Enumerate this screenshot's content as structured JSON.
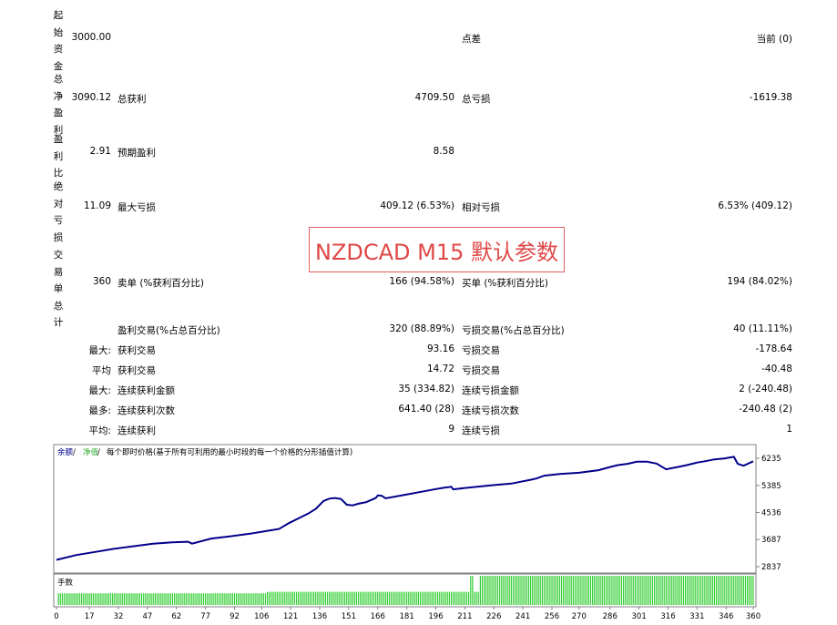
{
  "report": {
    "initial_deposit": {
      "label_chars": [
        "起",
        "始",
        "资",
        "金"
      ],
      "value": "3000.00",
      "spread_label": "点差",
      "spread_value": "当前 (0)"
    },
    "net_profit": {
      "label_chars": [
        "总",
        "净",
        "盈",
        "利"
      ],
      "value": "3090.12",
      "gross_profit_label": "总获利",
      "gross_profit_value": "4709.50",
      "gross_loss_label": "总亏损",
      "gross_loss_value": "-1619.38"
    },
    "profit_factor": {
      "label_chars": [
        "盈",
        "利",
        "比"
      ],
      "value": "2.91",
      "expected_payoff_label": "预期盈利",
      "expected_payoff_value": "8.58"
    },
    "absolute_drawdown": {
      "label_chars": [
        "绝",
        "对",
        "亏",
        "损"
      ],
      "value": "11.09",
      "max_dd_label": "最大亏损",
      "max_dd_value": "409.12 (6.53%)",
      "rel_dd_label": "相对亏损",
      "rel_dd_value": "6.53% (409.12)"
    },
    "total_trades": {
      "label_chars": [
        "交",
        "易",
        "单",
        "总",
        "计"
      ],
      "value": "360",
      "short_label": "卖单 (%获利百分比)",
      "short_value": "166 (94.58%)",
      "long_label": "买单 (%获利百分比)",
      "long_value": "194 (84.02%)"
    },
    "rows": [
      {
        "prefix": "",
        "l_label": "盈利交易(%占总百分比)",
        "l_value": "320 (88.89%)",
        "r_label": "亏损交易(%占总百分比)",
        "r_value": "40 (11.11%)"
      },
      {
        "prefix": "最大:",
        "l_label": "获利交易",
        "l_value": "93.16",
        "r_label": "亏损交易",
        "r_value": "-178.64"
      },
      {
        "prefix": "平均",
        "l_label": "获利交易",
        "l_value": "14.72",
        "r_label": "亏损交易",
        "r_value": "-40.48"
      },
      {
        "prefix": "最大:",
        "l_label": "连续获利金额",
        "l_value": "35 (334.82)",
        "r_label": "连续亏损金额",
        "r_value": "2 (-240.48)"
      },
      {
        "prefix": "最多:",
        "l_label": "连续获利次数",
        "l_value": "641.40 (28)",
        "r_label": "连续亏损次数",
        "r_value": "-240.48 (2)"
      },
      {
        "prefix": "平均:",
        "l_label": "连续获利",
        "l_value": "9",
        "r_label": "连续亏损",
        "r_value": "1"
      }
    ]
  },
  "stamp": "NZDCAD M15 默认参数",
  "chart": {
    "legend_balance": "余额",
    "legend_sep1": " / ",
    "legend_equity": "净值",
    "legend_sep2": " / ",
    "legend_text": "每个即时价格(基于所有可利用的最小时段的每一个价格的分形插值计算)",
    "lots_label": "手数",
    "colors": {
      "balance": "#00008b",
      "equity_legend": "#2fa82f",
      "lots": "#32cd32"
    }
  },
  "chart_data": {
    "type": "line",
    "y_ticks": [
      6235,
      5385,
      4536,
      3687,
      2837
    ],
    "x_ticks": [
      0,
      17,
      32,
      47,
      62,
      77,
      92,
      106,
      121,
      136,
      151,
      166,
      181,
      196,
      211,
      226,
      241,
      256,
      270,
      286,
      301,
      316,
      331,
      346,
      360
    ],
    "ylim": [
      2837,
      6235
    ],
    "xlim": [
      0,
      360
    ],
    "series": [
      {
        "name": "余额",
        "x": [
          0,
          10,
          20,
          30,
          40,
          50,
          60,
          68,
          70,
          80,
          90,
          100,
          108,
          115,
          120,
          125,
          130,
          134,
          138,
          141,
          144,
          147,
          150,
          153,
          156,
          160,
          165,
          166,
          168,
          170,
          180,
          190,
          196,
          200,
          204,
          205,
          215,
          225,
          235,
          240,
          245,
          248,
          252,
          260,
          270,
          275,
          280,
          286,
          290,
          295,
          300,
          305,
          310,
          315,
          320,
          325,
          331,
          335,
          340,
          345,
          350,
          352,
          355,
          360
        ],
        "y": [
          3050,
          3200,
          3300,
          3400,
          3480,
          3560,
          3600,
          3620,
          3560,
          3720,
          3790,
          3870,
          3950,
          4020,
          4200,
          4350,
          4500,
          4650,
          4900,
          4970,
          4990,
          4960,
          4780,
          4760,
          4810,
          4860,
          4990,
          5070,
          5060,
          4980,
          5090,
          5200,
          5270,
          5310,
          5340,
          5260,
          5330,
          5390,
          5440,
          5500,
          5560,
          5600,
          5690,
          5740,
          5780,
          5820,
          5860,
          5960,
          6020,
          6060,
          6130,
          6130,
          6070,
          5890,
          5950,
          6010,
          6100,
          6140,
          6200,
          6230,
          6280,
          6060,
          6000,
          6140
        ]
      }
    ],
    "lots": [
      {
        "from": 0,
        "to": 108,
        "value": 0.4
      },
      {
        "from": 108,
        "to": 213,
        "value": 0.45
      },
      {
        "from": 213,
        "to": 215,
        "value": 1.0
      },
      {
        "from": 215,
        "to": 218,
        "value": 0.45
      },
      {
        "from": 218,
        "to": 360,
        "value": 1.0
      }
    ]
  }
}
